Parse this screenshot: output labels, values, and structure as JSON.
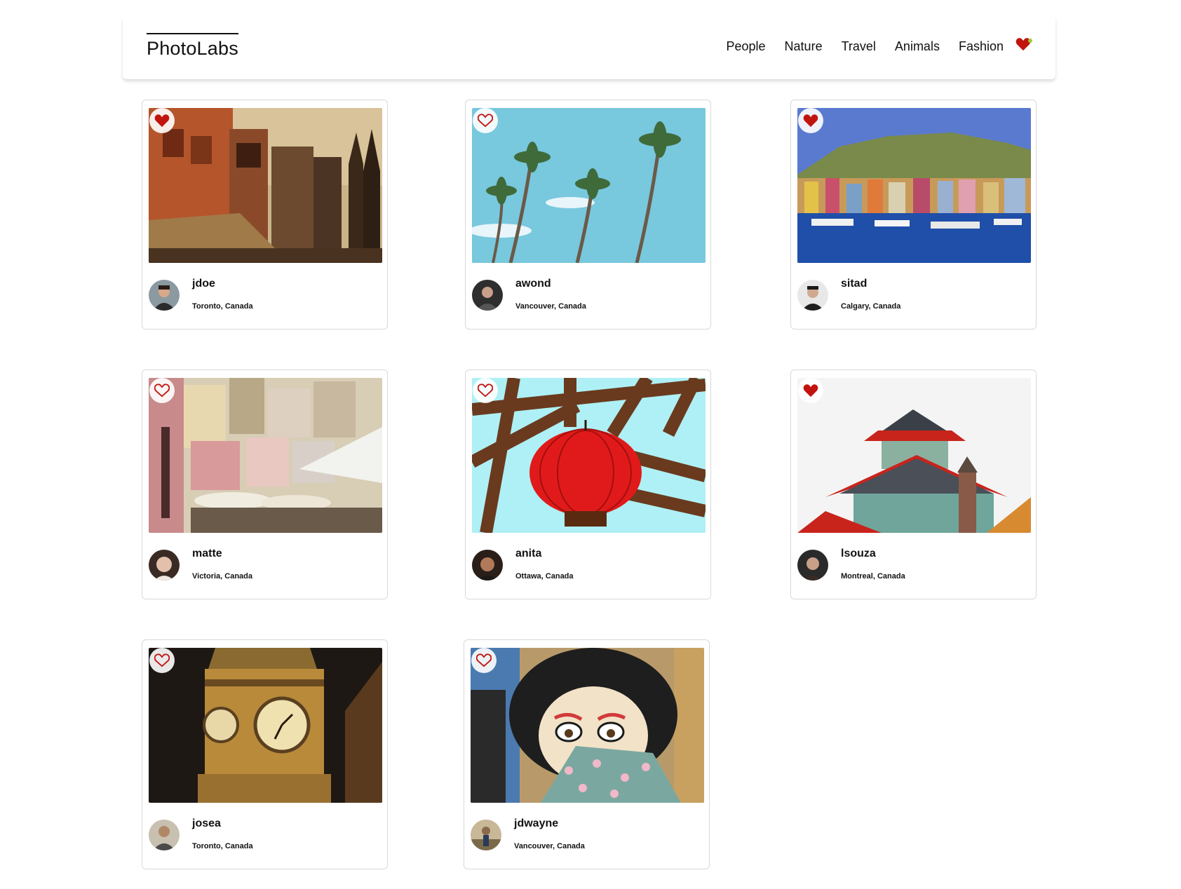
{
  "app": {
    "logo": "PhotoLabs"
  },
  "nav": {
    "topics": [
      "People",
      "Nature",
      "Travel",
      "Animals",
      "Fashion"
    ],
    "fav_icon": "heart-icon",
    "fav_notification": true
  },
  "colors": {
    "heart": "#c2140f",
    "accent_dot": "#9acd32",
    "border": "#d9d9d9"
  },
  "photos": [
    {
      "username": "jdoe",
      "location": "Toronto, Canada",
      "favorited": true,
      "image": "old-town-buildings"
    },
    {
      "username": "awond",
      "location": "Vancouver, Canada",
      "favorited": false,
      "image": "palm-trees"
    },
    {
      "username": "sitad",
      "location": "Calgary, Canada",
      "favorited": true,
      "image": "colorful-harbor"
    },
    {
      "username": "matte",
      "location": "Victoria, Canada",
      "favorited": false,
      "image": "coastal-village"
    },
    {
      "username": "anita",
      "location": "Ottawa, Canada",
      "favorited": false,
      "image": "red-lantern"
    },
    {
      "username": "lsouza",
      "location": "Montreal, Canada",
      "favorited": true,
      "image": "pagoda-roof"
    },
    {
      "username": "josea",
      "location": "Toronto, Canada",
      "favorited": false,
      "image": "clock-tower"
    },
    {
      "username": "jdwayne",
      "location": "Vancouver, Canada",
      "favorited": false,
      "image": "geisha-mural"
    }
  ]
}
